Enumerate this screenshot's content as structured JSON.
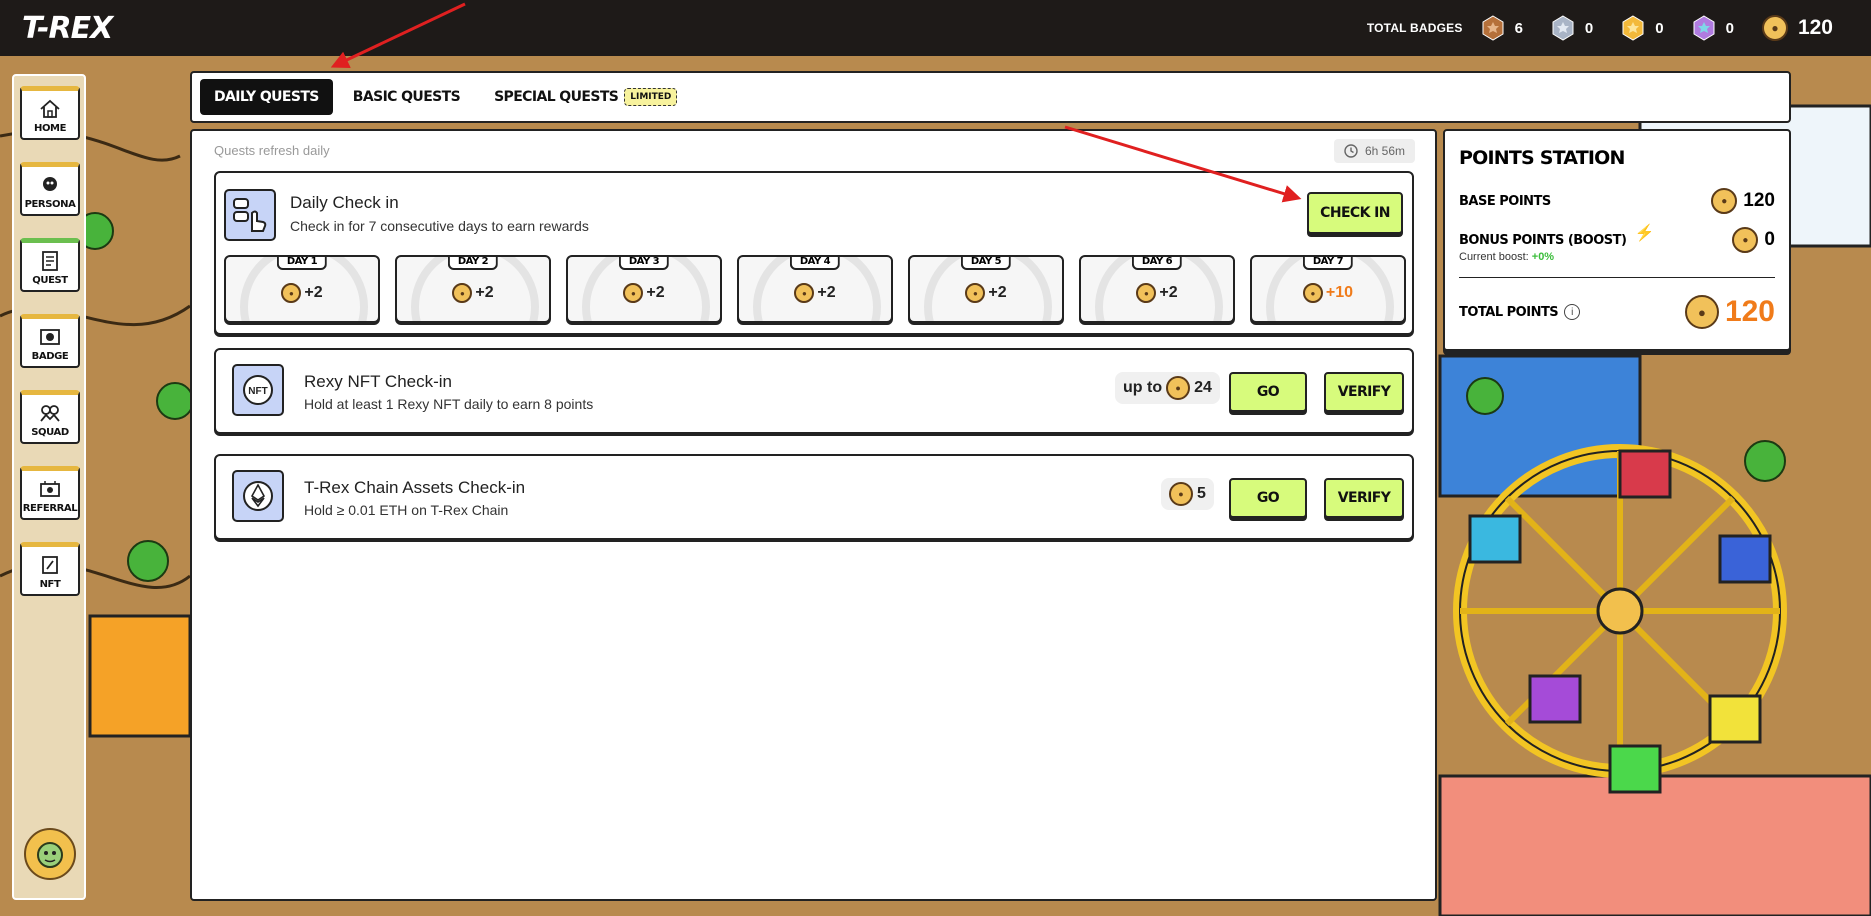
{
  "header": {
    "logo": "T-REX",
    "badges_label": "TOTAL BADGES",
    "badges": [
      {
        "name": "bronze",
        "count": "6",
        "color": "#b5703a"
      },
      {
        "name": "silver",
        "count": "0",
        "color": "#a9b4c6"
      },
      {
        "name": "gold",
        "count": "0",
        "color": "#f3b93a"
      },
      {
        "name": "rainbow",
        "count": "0",
        "color": "#b07be0"
      }
    ],
    "total_points": "120"
  },
  "sidebar": {
    "items": [
      {
        "label": "HOME",
        "icon": "home-icon"
      },
      {
        "label": "PERSONA",
        "icon": "persona-icon"
      },
      {
        "label": "QUEST",
        "icon": "quest-icon",
        "active": true
      },
      {
        "label": "BADGE",
        "icon": "badge-icon"
      },
      {
        "label": "SQUAD",
        "icon": "squad-icon"
      },
      {
        "label": "REFERRAL",
        "icon": "referral-icon"
      },
      {
        "label": "NFT",
        "icon": "nft-icon"
      }
    ]
  },
  "tabs": [
    {
      "label": "DAILY QUESTS",
      "active": true
    },
    {
      "label": "BASIC QUESTS"
    },
    {
      "label": "SPECIAL QUESTS",
      "tag": "LIMITED"
    }
  ],
  "panel": {
    "refresh_note": "Quests refresh daily",
    "timer": "6h 56m",
    "daily_checkin": {
      "title": "Daily Check in",
      "desc": "Check in for 7 consecutive days to earn rewards",
      "button": "CHECK IN",
      "days": [
        {
          "label": "DAY 1",
          "reward": "+2"
        },
        {
          "label": "DAY 2",
          "reward": "+2"
        },
        {
          "label": "DAY 3",
          "reward": "+2"
        },
        {
          "label": "DAY 4",
          "reward": "+2"
        },
        {
          "label": "DAY 5",
          "reward": "+2"
        },
        {
          "label": "DAY 6",
          "reward": "+2"
        },
        {
          "label": "DAY 7",
          "reward": "+10"
        }
      ]
    },
    "nft_checkin": {
      "title": "Rexy NFT Check-in",
      "desc": "Hold at least 1 Rexy NFT daily to earn 8 points",
      "reward_prefix": "up to",
      "reward": "24",
      "icon_text": "NFT",
      "go": "GO",
      "verify": "VERIFY"
    },
    "chain_checkin": {
      "title": "T-Rex Chain Assets Check-in",
      "desc": "Hold ≥ 0.01 ETH on T-Rex Chain",
      "reward": "5",
      "go": "GO",
      "verify": "VERIFY"
    }
  },
  "station": {
    "title": "POINTS STATION",
    "base_label": "BASE POINTS",
    "base_value": "120",
    "bonus_label": "BONUS POINTS (BOOST)",
    "bonus_value": "0",
    "boost_label": "Current boost:",
    "boost_value": "+0%",
    "total_label": "TOTAL POINTS",
    "total_value": "120"
  },
  "colors": {
    "accent_green": "#d7fb7c",
    "orange": "#f07b1a",
    "topbar": "#1e1a18"
  }
}
